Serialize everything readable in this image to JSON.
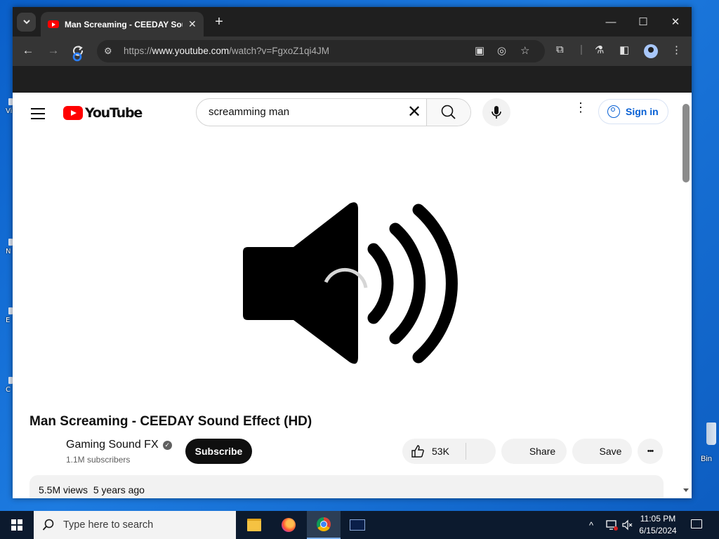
{
  "browser": {
    "tab_title": "Man Screaming - CEEDAY Sound Effect (HD)",
    "tab_close": "✕",
    "new_tab": "+",
    "url_prefix": "https://",
    "url_host": "www.youtube.com",
    "url_path": "/watch?v=FgxoZ1qi4JM",
    "controls": {
      "minimize": "—",
      "maximize": "☐",
      "close": "✕"
    },
    "nav": {
      "back": "←",
      "forward": "→",
      "reload": "↻"
    }
  },
  "youtube": {
    "logo_text": "YouTube",
    "search_query": "screamming man",
    "clear_symbol": "✕",
    "signin_label": "Sign in",
    "more_symbol": "⋮"
  },
  "video": {
    "title": "Man Screaming - CEEDAY Sound Effect (HD)",
    "channel": "Gaming Sound FX",
    "verified_symbol": "✓",
    "subscribers": "1.1M subscribers",
    "subscribe_label": "Subscribe",
    "likes": "53K",
    "share_label": "Share",
    "save_label": "Save",
    "views": "5.5M views",
    "age": "5 years ago",
    "more_actions": "•••"
  },
  "desktop": {
    "recycle_bin_label": "Bin",
    "left_fragments": [
      "Vis",
      "N",
      "E",
      "C"
    ]
  },
  "taskbar": {
    "search_placeholder": "Type here to search",
    "time": "11:05 PM",
    "date": "6/15/2024",
    "tray_chevron": "^"
  },
  "colors": {
    "youtube_red": "#ff0000",
    "link_blue": "#065fd4",
    "browser_dark": "#1f1f1f"
  }
}
